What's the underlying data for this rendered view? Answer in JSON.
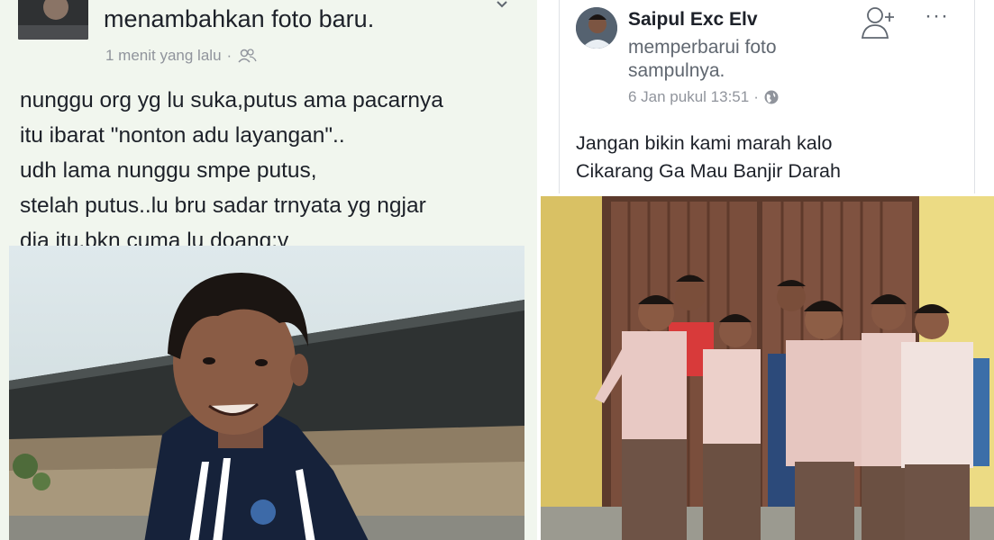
{
  "left_post": {
    "action_text": "menambahkan foto baru.",
    "timestamp": "1 menit yang lalu",
    "separator": "·",
    "privacy_icon": "friends-icon",
    "menu_icon": "chevron-down-icon",
    "body_lines": [
      "nunggu org yg lu suka,putus ama pacarnya",
      "itu ibarat \"nonton adu layangan\"..",
      "udh lama nunggu smpe putus,",
      "stelah putus..lu bru sadar trnyata yg ngjar",
      "dia itu,bkn cuma lu doang:v"
    ],
    "photo": "boy-in-navy-jacket-photo"
  },
  "right_post": {
    "author": "Saipul Exc Elv",
    "action_text": "memperbarui foto sampulnya.",
    "timestamp": "6 Jan pukul 13:51",
    "separator": "·",
    "privacy_icon": "globe-icon",
    "add_friend_icon": "add-friend-icon",
    "more_icon": "more-options-icon",
    "more_label": "···",
    "body_lines": [
      "Jangan bikin kami marah kalo",
      "Cikarang Ga Mau Banjir Darah"
    ],
    "photo": "group-of-schoolboys-photo"
  },
  "colors": {
    "left_background": "#f1f6ee",
    "text_primary": "#1d2129",
    "text_secondary": "#90949c",
    "uniform_pink": "#e8c9c4",
    "uniform_brown": "#6e5346",
    "door_wood": "#7a4e3c",
    "wall_yellow": "#e7d27a"
  }
}
